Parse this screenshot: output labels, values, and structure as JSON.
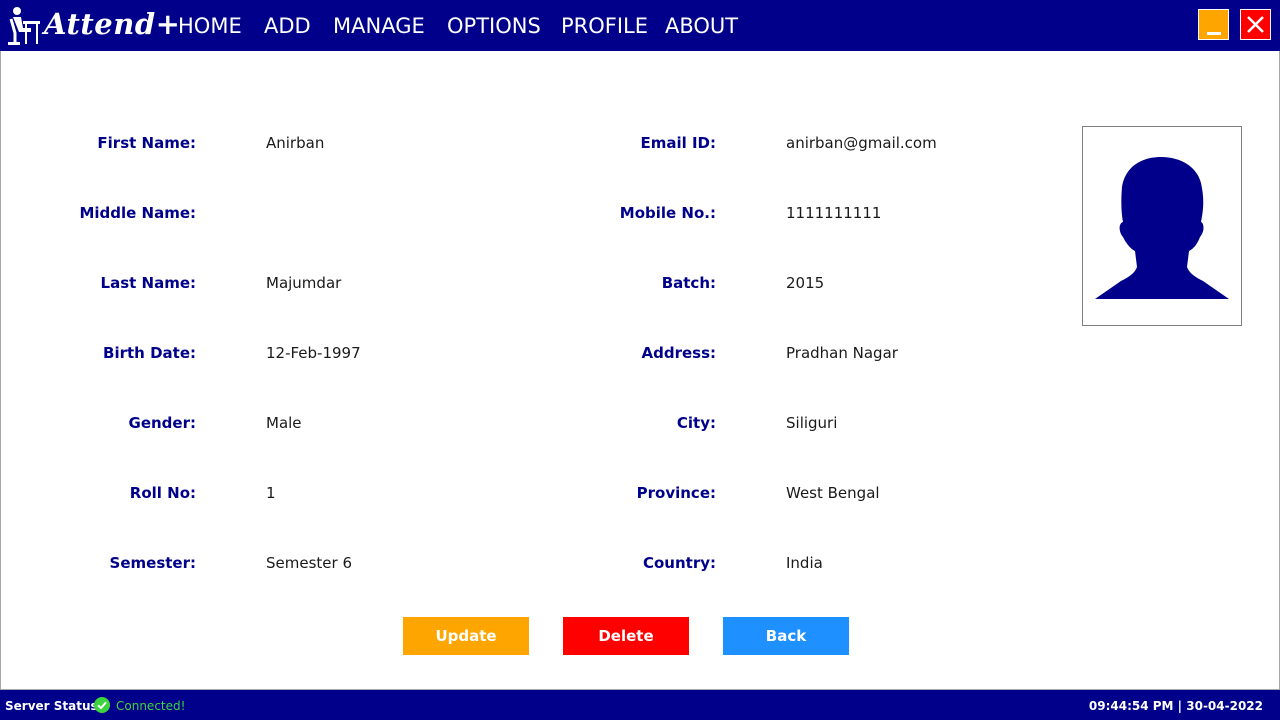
{
  "app": {
    "title": "Attend+"
  },
  "nav": {
    "items": [
      "HOME",
      "ADD",
      "MANAGE",
      "OPTIONS",
      "PROFILE",
      "ABOUT"
    ]
  },
  "window_controls": {
    "minimize_icon": "minimize-icon",
    "close_icon": "close-icon",
    "minimize_color": "#ffa500",
    "close_color": "#ff0000"
  },
  "colors": {
    "primary": "#00008b",
    "update": "#ffa500",
    "delete": "#ff0000",
    "back": "#1e90ff",
    "connected": "#3cd43c"
  },
  "student": {
    "left_fields": [
      {
        "label": "First Name:",
        "value": "Anirban"
      },
      {
        "label": "Middle Name:",
        "value": ""
      },
      {
        "label": "Last Name:",
        "value": "Majumdar"
      },
      {
        "label": "Birth Date:",
        "value": "12-Feb-1997"
      },
      {
        "label": "Gender:",
        "value": "Male"
      },
      {
        "label": "Roll No:",
        "value": "1"
      },
      {
        "label": "Semester:",
        "value": "Semester 6"
      }
    ],
    "right_fields": [
      {
        "label": "Email ID:",
        "value": "anirban@gmail.com"
      },
      {
        "label": "Mobile No.:",
        "value": "1111111111"
      },
      {
        "label": "Batch:",
        "value": "2015"
      },
      {
        "label": "Address:",
        "value": "Pradhan Nagar"
      },
      {
        "label": "City:",
        "value": "Siliguri"
      },
      {
        "label": "Province:",
        "value": "West Bengal"
      },
      {
        "label": "Country:",
        "value": "India"
      }
    ],
    "photo_icon": "user-silhouette-icon"
  },
  "actions": {
    "update_label": "Update",
    "delete_label": "Delete",
    "back_label": "Back"
  },
  "status": {
    "label": "Server Status:",
    "value": "Connected!",
    "icon": "check-circle-icon",
    "datetime": "09:44:54 PM | 30-04-2022"
  }
}
